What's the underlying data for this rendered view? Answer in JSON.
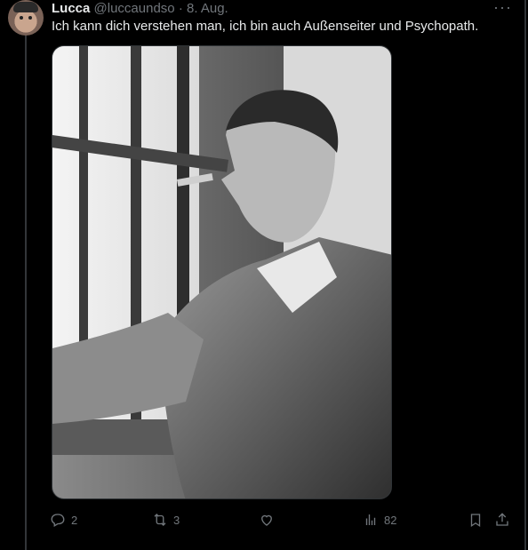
{
  "tweet": {
    "display_name": "Lucca",
    "handle": "@luccaundso",
    "separator": "·",
    "date": "8. Aug.",
    "more_label": "···",
    "text": "Ich kann dich verstehen man, ich bin auch Außenseiter und Psychopath."
  },
  "actions": {
    "reply_count": "2",
    "retweet_count": "3",
    "like_count": "",
    "views_count": "82"
  },
  "icons": [
    "reply-icon",
    "retweet-icon",
    "like-icon",
    "views-icon",
    "bookmark-icon",
    "share-icon",
    "more-icon"
  ],
  "colors": {
    "background": "#000000",
    "text": "#e7e9ea",
    "muted": "#71767b",
    "divider": "#2f3336"
  }
}
